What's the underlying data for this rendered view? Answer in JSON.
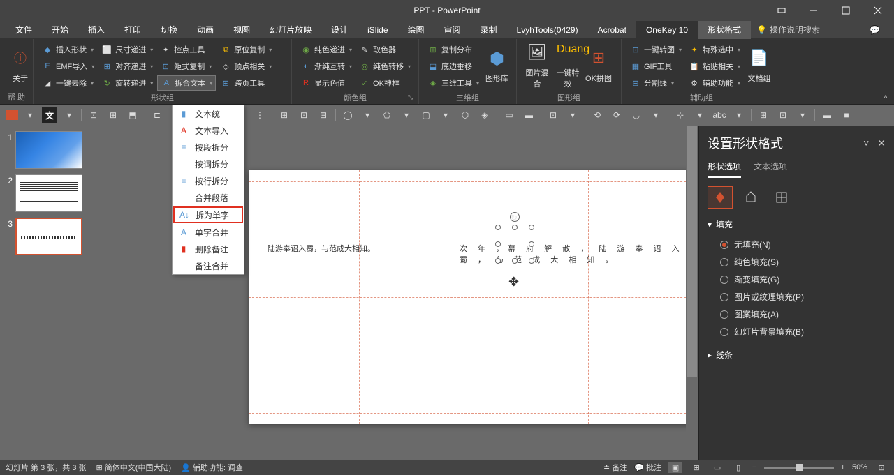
{
  "title": "PPT - PowerPoint",
  "tabs": [
    "文件",
    "开始",
    "插入",
    "打印",
    "切换",
    "动画",
    "视图",
    "幻灯片放映",
    "设计",
    "iSlide",
    "绘图",
    "审阅",
    "录制",
    "LvyhTools(0429)",
    "Acrobat",
    "OneKey 10",
    "形状格式"
  ],
  "active_tab": "OneKey 10",
  "shape_tab": "形状格式",
  "help_hint": "操作说明搜索",
  "ribbon": {
    "g0": {
      "label": "帮 助",
      "about": "关于"
    },
    "g1": {
      "label": "形状组",
      "items": [
        "插入形状",
        "尺寸递进",
        "控点工具",
        "原位复制",
        "EMF导入",
        "对齐递进",
        "矩式复制",
        "顶点相关",
        "一键去除",
        "旋转递进",
        "拆合文本",
        "跨页工具"
      ]
    },
    "g2": {
      "label": "颜色组",
      "items": [
        "纯色递进",
        "取色器",
        "渐纯互转",
        "纯色转移",
        "显示色值",
        "OK神框"
      ]
    },
    "g3": {
      "label": "三维组",
      "items": [
        "复制分布",
        "底边垂移",
        "三维工具"
      ],
      "big": "图形库"
    },
    "g4": {
      "label": "图形组",
      "big": [
        "图片混合",
        "一键特效",
        "OK拼图"
      ]
    },
    "g5": {
      "label": "辅助组",
      "items": [
        "一键转图",
        "特殊选中",
        "GIF工具",
        "粘贴相关",
        "分割线",
        "辅助功能"
      ],
      "big": "文档组"
    }
  },
  "dropdown": {
    "items": [
      "文本统一",
      "文本导入",
      "按段拆分",
      "按词拆分",
      "按行拆分",
      "合并段落",
      "拆为单字",
      "单字合并",
      "删除备注",
      "备注合并"
    ],
    "highlighted": "拆为单字"
  },
  "slide_text1": "陆游奉诏入蜀，与范成大相知。",
  "slide_text2": "次 年 ，幕 府 解 散 ， 陆 游 奉 诏 入 蜀 ， 与 范 成 大 相 知 。",
  "panel": {
    "title": "设置形状格式",
    "tabs": [
      "形状选项",
      "文本选项"
    ],
    "sections": {
      "fill": "填充",
      "line": "线条"
    },
    "fill_options": [
      "无填充(N)",
      "纯色填充(S)",
      "渐变填充(G)",
      "图片或纹理填充(P)",
      "图案填充(A)",
      "幻灯片背景填充(B)"
    ],
    "selected_fill": "无填充(N)"
  },
  "status": {
    "slide_info": "幻灯片 第 3 张，共 3 张",
    "lang": "简体中文(中国大陆)",
    "access": "辅助功能: 调查",
    "notes": "备注",
    "comments": "批注",
    "zoom": "50%"
  },
  "thumbs": [
    1,
    2,
    3
  ]
}
